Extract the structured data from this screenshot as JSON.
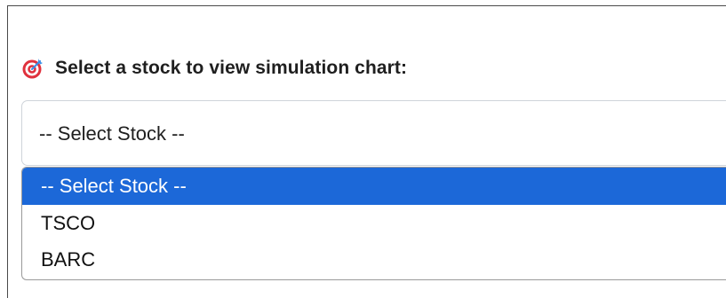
{
  "prompt": {
    "icon": "target-icon",
    "text": "Select a stock to view simulation chart:"
  },
  "select": {
    "value": "-- Select Stock --"
  },
  "dropdown": {
    "options": [
      {
        "label": "-- Select Stock --",
        "selected": true
      },
      {
        "label": "TSCO",
        "selected": false
      },
      {
        "label": "BARC",
        "selected": false
      }
    ]
  },
  "colors": {
    "highlight": "#1c68d8",
    "target_red": "#e0313d",
    "target_blue": "#3a8fe6"
  }
}
